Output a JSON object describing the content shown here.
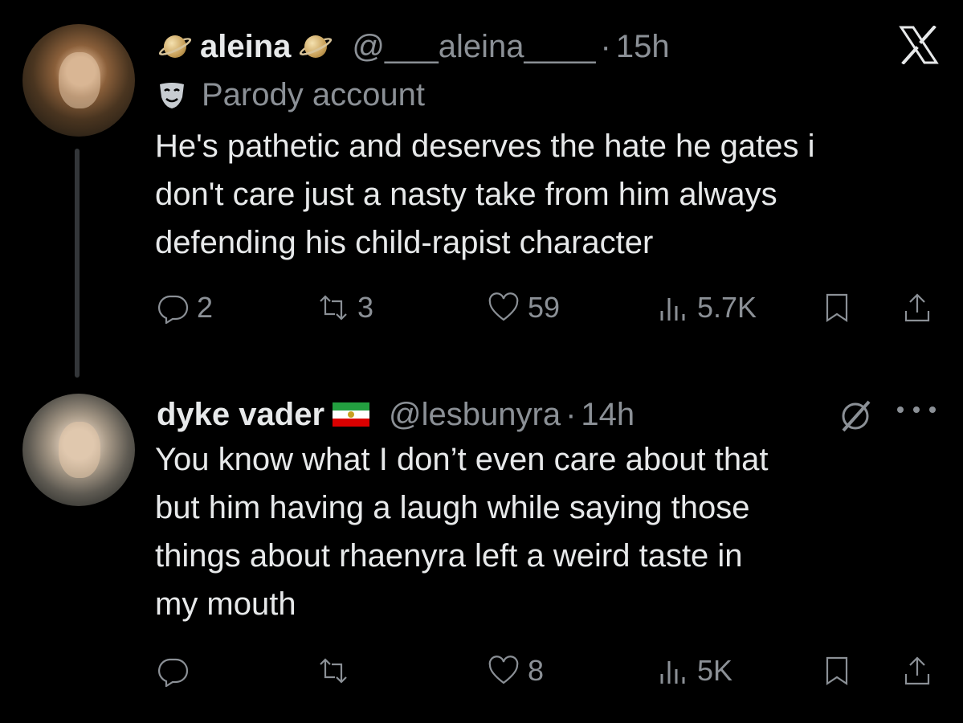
{
  "tweets": [
    {
      "display_name": "aleina",
      "handle": "@___aleina____",
      "separator": "·",
      "time": "15h",
      "parody_label": "Parody account",
      "text": "He's pathetic and deserves the hate he gates i\ndon't care just a nasty take from him always\ndefending his child-rapist character",
      "replies": "2",
      "reposts": "3",
      "likes": "59",
      "views": "5.7K"
    },
    {
      "display_name": "dyke vader",
      "handle": "@lesbunyra",
      "separator": "·",
      "time": "14h",
      "text": "You know what I don’t even care about that\nbut him having a laugh while saying those\nthings about rhaenyra left a weird taste in\nmy mouth",
      "likes": "8",
      "views": "5K"
    }
  ],
  "icons": {
    "platform_logo": "x-logo-icon",
    "name_emoji": "ringed-planet-emoji",
    "flag_emoji": "iran-lion-sun-flag-emoji",
    "parody_badge": "theater-mask-icon",
    "reply": "reply-icon",
    "repost": "repost-icon",
    "like": "heart-icon",
    "views": "views-icon",
    "bookmark": "bookmark-icon",
    "share": "share-icon",
    "grok": "grok-icon",
    "more": "more-icon"
  },
  "colors": {
    "background": "#000000",
    "primary_text": "#e7e9ea",
    "secondary_text": "#8b9096",
    "thread_line": "#333639"
  }
}
